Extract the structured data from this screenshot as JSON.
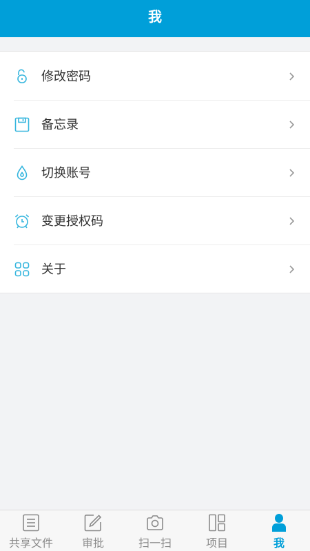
{
  "header": {
    "title": "我"
  },
  "menu": {
    "items": [
      {
        "label": "修改密码",
        "icon": "unlock-icon"
      },
      {
        "label": "备忘录",
        "icon": "floppy-disk-icon"
      },
      {
        "label": "切换账号",
        "icon": "water-drop-icon"
      },
      {
        "label": "变更授权码",
        "icon": "alarm-clock-icon"
      },
      {
        "label": "关于",
        "icon": "grid-icon"
      }
    ]
  },
  "tabbar": {
    "tabs": [
      {
        "label": "共享文件",
        "icon": "document-list-icon",
        "active": false
      },
      {
        "label": "审批",
        "icon": "edit-icon",
        "active": false
      },
      {
        "label": "扫一扫",
        "icon": "camera-icon",
        "active": false
      },
      {
        "label": "项目",
        "icon": "layout-icon",
        "active": false
      },
      {
        "label": "我",
        "icon": "user-icon",
        "active": true
      }
    ]
  },
  "colors": {
    "primary": "#009fd9",
    "icon_accent": "#36b6de",
    "background": "#f2f3f5",
    "inactive_tab": "#8a8a8a"
  }
}
